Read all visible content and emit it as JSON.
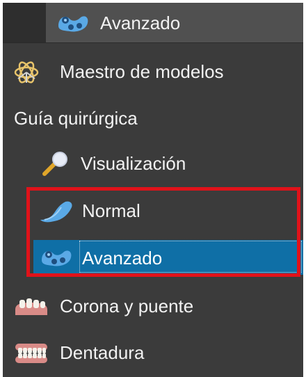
{
  "header": {
    "title": "Avanzado",
    "icon": "advanced-guide-icon"
  },
  "items": [
    {
      "label": "Maestro de modelos",
      "icon": "model-master-icon"
    },
    {
      "label": "Guía quirúrgica"
    },
    {
      "label": "Visualización",
      "icon": "magnifier-icon"
    },
    {
      "label": "Normal",
      "icon": "normal-guide-icon"
    },
    {
      "label": "Avanzado",
      "icon": "advanced-guide-icon",
      "selected": true
    },
    {
      "label": "Corona y puente",
      "icon": "crown-bridge-icon"
    },
    {
      "label": "Dentadura",
      "icon": "denture-icon"
    }
  ],
  "colors": {
    "panel": "#3b3b3b",
    "header": "#505050",
    "selection": "#0f6fa6",
    "highlight": "#e0121a"
  }
}
